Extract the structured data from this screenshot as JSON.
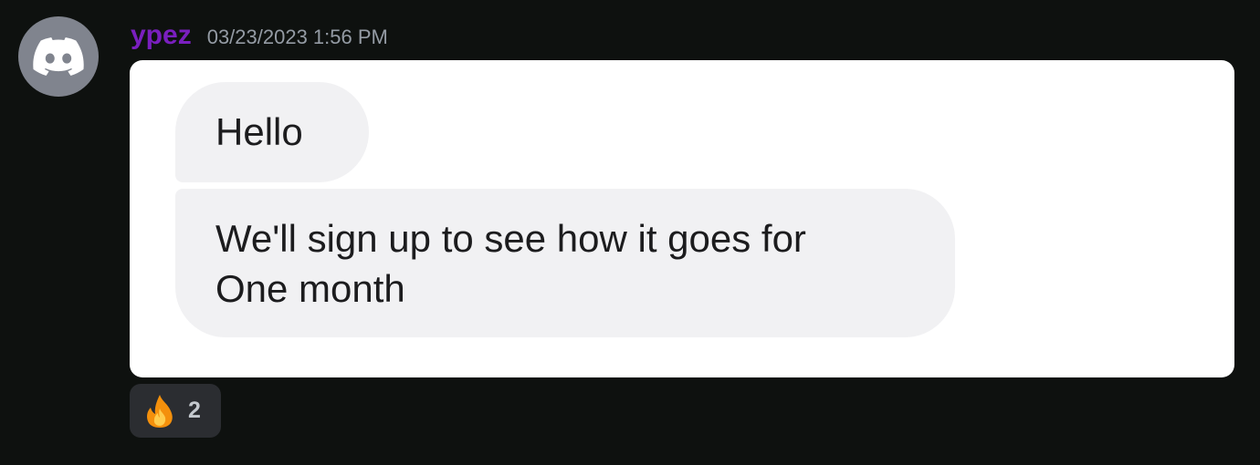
{
  "message": {
    "author": {
      "username": "ypez",
      "avatar_icon": "discord-logo-icon",
      "username_color": "#7a1fbf"
    },
    "timestamp": "03/23/2023 1:56 PM",
    "attachment": {
      "type": "image",
      "bubbles": [
        {
          "lines": [
            "Hello"
          ]
        },
        {
          "lines": [
            "We'll sign up to see how it goes for",
            "One month"
          ]
        }
      ]
    },
    "reactions": [
      {
        "emoji_icon": "fire-emoji-icon",
        "count": "2"
      }
    ]
  }
}
